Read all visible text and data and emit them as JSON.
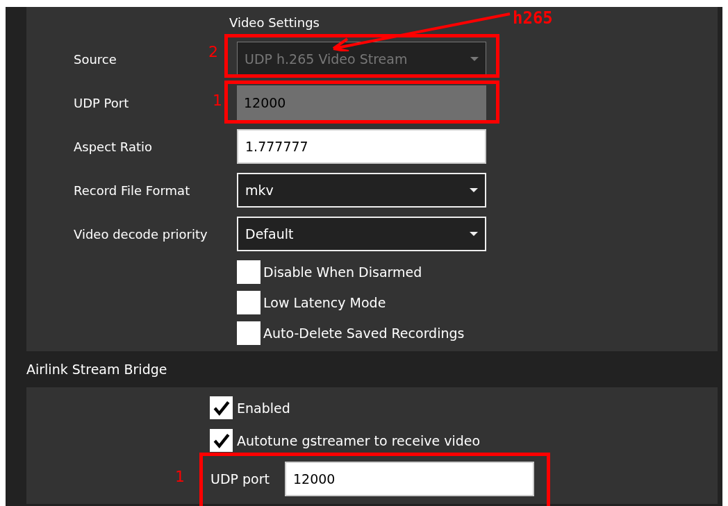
{
  "video_settings": {
    "title": "Video Settings",
    "fields": [
      {
        "kind": "dropdown",
        "label": "Source",
        "value": "UDP h.265 Video Stream",
        "disabled": true
      },
      {
        "kind": "text",
        "label": "UDP Port",
        "value": "12000",
        "disabled": true
      },
      {
        "kind": "text",
        "label": "Aspect Ratio",
        "value": "1.777777",
        "disabled": false
      },
      {
        "kind": "dropdown",
        "label": "Record File Format",
        "value": "mkv",
        "disabled": false
      },
      {
        "kind": "dropdown",
        "label": "Video decode priority",
        "value": "Default",
        "disabled": false
      }
    ],
    "checkboxes": [
      {
        "label": "Disable When Disarmed",
        "checked": false
      },
      {
        "label": "Low Latency Mode",
        "checked": false
      },
      {
        "label": "Auto-Delete Saved Recordings",
        "checked": false
      }
    ]
  },
  "airlink": {
    "title": "Airlink Stream Bridge",
    "checkboxes": [
      {
        "label": "Enabled",
        "checked": true
      },
      {
        "label": "Autotune gstreamer to receive video",
        "checked": true
      }
    ],
    "port": {
      "label": "UDP port",
      "value": "12000"
    }
  },
  "annotations": [
    {
      "kind": "arrow",
      "text": "h265"
    },
    {
      "kind": "box",
      "number": "2"
    },
    {
      "kind": "box",
      "number": "1"
    },
    {
      "kind": "box",
      "number": "1"
    }
  ]
}
